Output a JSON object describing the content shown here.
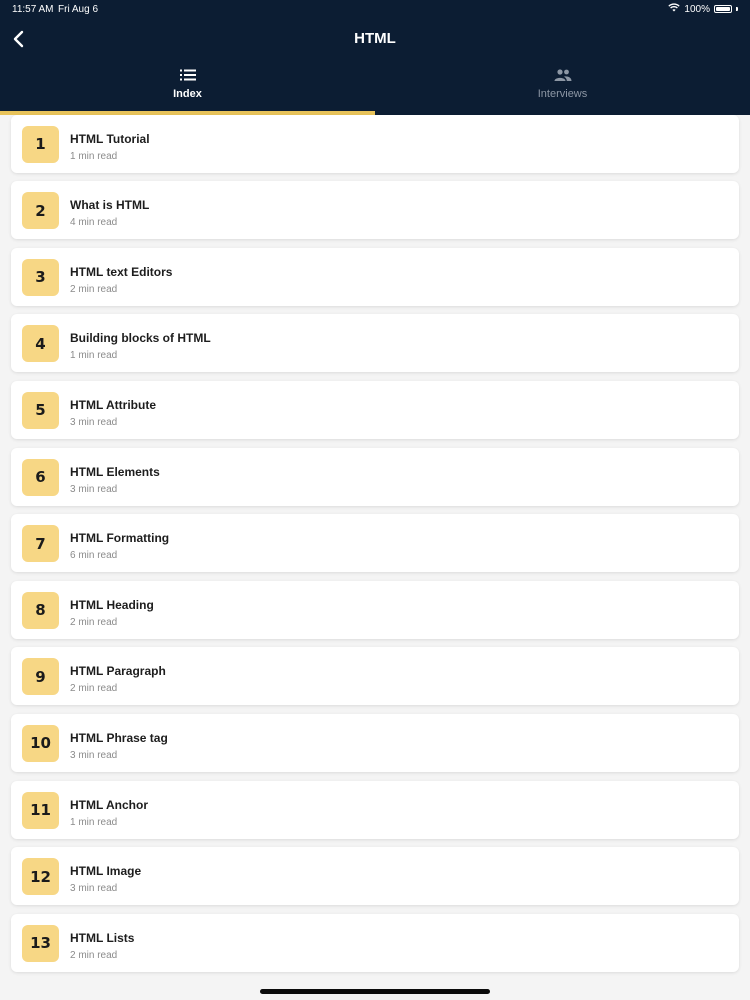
{
  "status_bar": {
    "time": "11:57 AM",
    "date": "Fri Aug 6",
    "battery": "100%"
  },
  "header": {
    "title": "HTML"
  },
  "tabs": [
    {
      "label": "Index",
      "icon": "list-icon",
      "active": true
    },
    {
      "label": "Interviews",
      "icon": "people-icon",
      "active": false
    }
  ],
  "colors": {
    "header_bg": "#0c1d33",
    "accent": "#e8c35a",
    "badge_bg": "#f7d785"
  },
  "items": [
    {
      "number": "1",
      "title": "HTML Tutorial",
      "read": "1 min read"
    },
    {
      "number": "2",
      "title": "What is HTML",
      "read": "4 min read"
    },
    {
      "number": "3",
      "title": "HTML text Editors",
      "read": "2 min read"
    },
    {
      "number": "4",
      "title": "Building blocks of HTML",
      "read": "1 min read"
    },
    {
      "number": "5",
      "title": "HTML Attribute",
      "read": "3 min read"
    },
    {
      "number": "6",
      "title": "HTML Elements",
      "read": "3 min read"
    },
    {
      "number": "7",
      "title": "HTML Formatting",
      "read": "6 min read"
    },
    {
      "number": "8",
      "title": "HTML Heading",
      "read": "2 min read"
    },
    {
      "number": "9",
      "title": "HTML Paragraph",
      "read": "2 min read"
    },
    {
      "number": "10",
      "title": "HTML Phrase tag",
      "read": "3 min read"
    },
    {
      "number": "11",
      "title": "HTML Anchor",
      "read": "1 min read"
    },
    {
      "number": "12",
      "title": "HTML Image",
      "read": "3 min read"
    },
    {
      "number": "13",
      "title": "HTML Lists",
      "read": "2 min read"
    }
  ]
}
